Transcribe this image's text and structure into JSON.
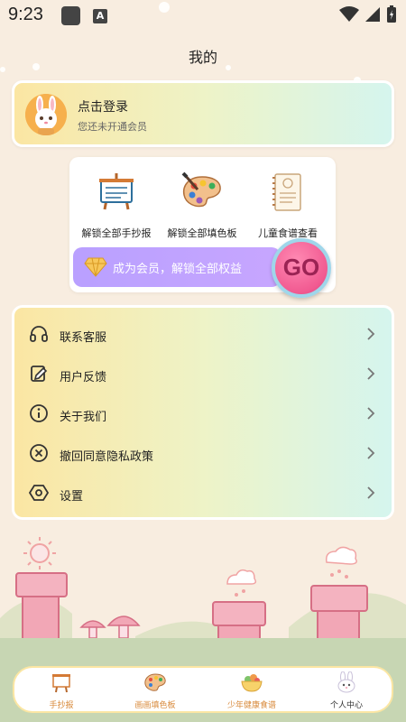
{
  "status": {
    "time": "9:23"
  },
  "page": {
    "title": "我的"
  },
  "login": {
    "title": "点击登录",
    "subtitle": "您还未开通会员"
  },
  "member": {
    "features": [
      {
        "label": "解锁全部手抄报",
        "icon": "easel-icon"
      },
      {
        "label": "解锁全部填色板",
        "icon": "palette-icon"
      },
      {
        "label": "儿童食谱查看",
        "icon": "recipe-icon"
      }
    ],
    "bar_text": "成为会员，解锁全部权益",
    "go_label": "GO"
  },
  "menu": [
    {
      "label": "联系客服",
      "icon": "headset-icon"
    },
    {
      "label": "用户反馈",
      "icon": "feedback-icon"
    },
    {
      "label": "关于我们",
      "icon": "info-icon"
    },
    {
      "label": "撤回同意隐私政策",
      "icon": "revoke-icon"
    },
    {
      "label": "设置",
      "icon": "settings-icon"
    }
  ],
  "nav": [
    {
      "label": "手抄报",
      "icon": "easel-icon"
    },
    {
      "label": "画画填色板",
      "icon": "palette-icon"
    },
    {
      "label": "少年健康食谱",
      "icon": "food-bowl-icon"
    },
    {
      "label": "个人中心",
      "icon": "bunny-icon",
      "active": true
    }
  ],
  "colors": {
    "accent": "#f15a91",
    "member_bar": "#b9a0ff",
    "nav_text": "#d88a3b"
  }
}
